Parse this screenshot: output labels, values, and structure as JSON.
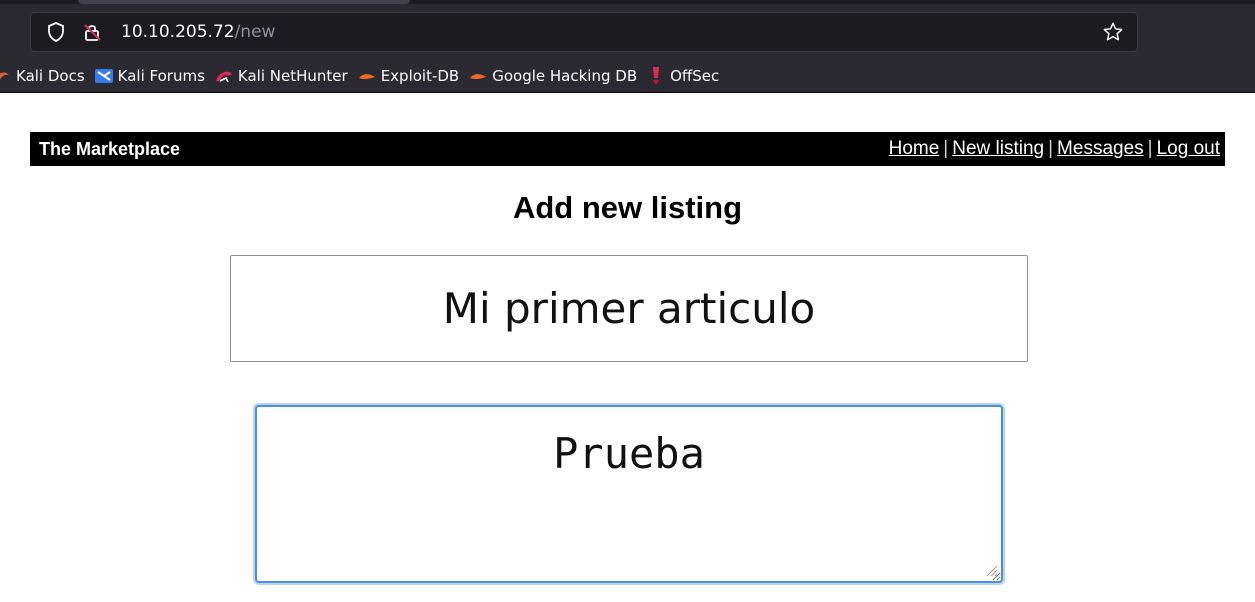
{
  "browser": {
    "url_host": "10.10.205.72",
    "url_path": "/new",
    "bookmarks": [
      {
        "label": "Kali Docs",
        "icon": "kali-dragon-icon"
      },
      {
        "label": "Kali Forums",
        "icon": "kali-forums-icon"
      },
      {
        "label": "Kali NetHunter",
        "icon": "nethunter-icon"
      },
      {
        "label": "Exploit-DB",
        "icon": "exploit-db-icon"
      },
      {
        "label": "Google Hacking DB",
        "icon": "ghdb-icon"
      },
      {
        "label": "OffSec",
        "icon": "offsec-icon"
      }
    ]
  },
  "header": {
    "brand": "The Marketplace",
    "nav": [
      {
        "label": "Home"
      },
      {
        "label": "New listing"
      },
      {
        "label": "Messages"
      },
      {
        "label": "Log out"
      }
    ],
    "separator": "|"
  },
  "form": {
    "heading": "Add new listing",
    "title_value": "Mi primer articulo",
    "description_value": "Prueba"
  },
  "colors": {
    "header_bg": "#000000",
    "focus_border": "#4a90d9",
    "browser_bg": "#2b2a33"
  }
}
